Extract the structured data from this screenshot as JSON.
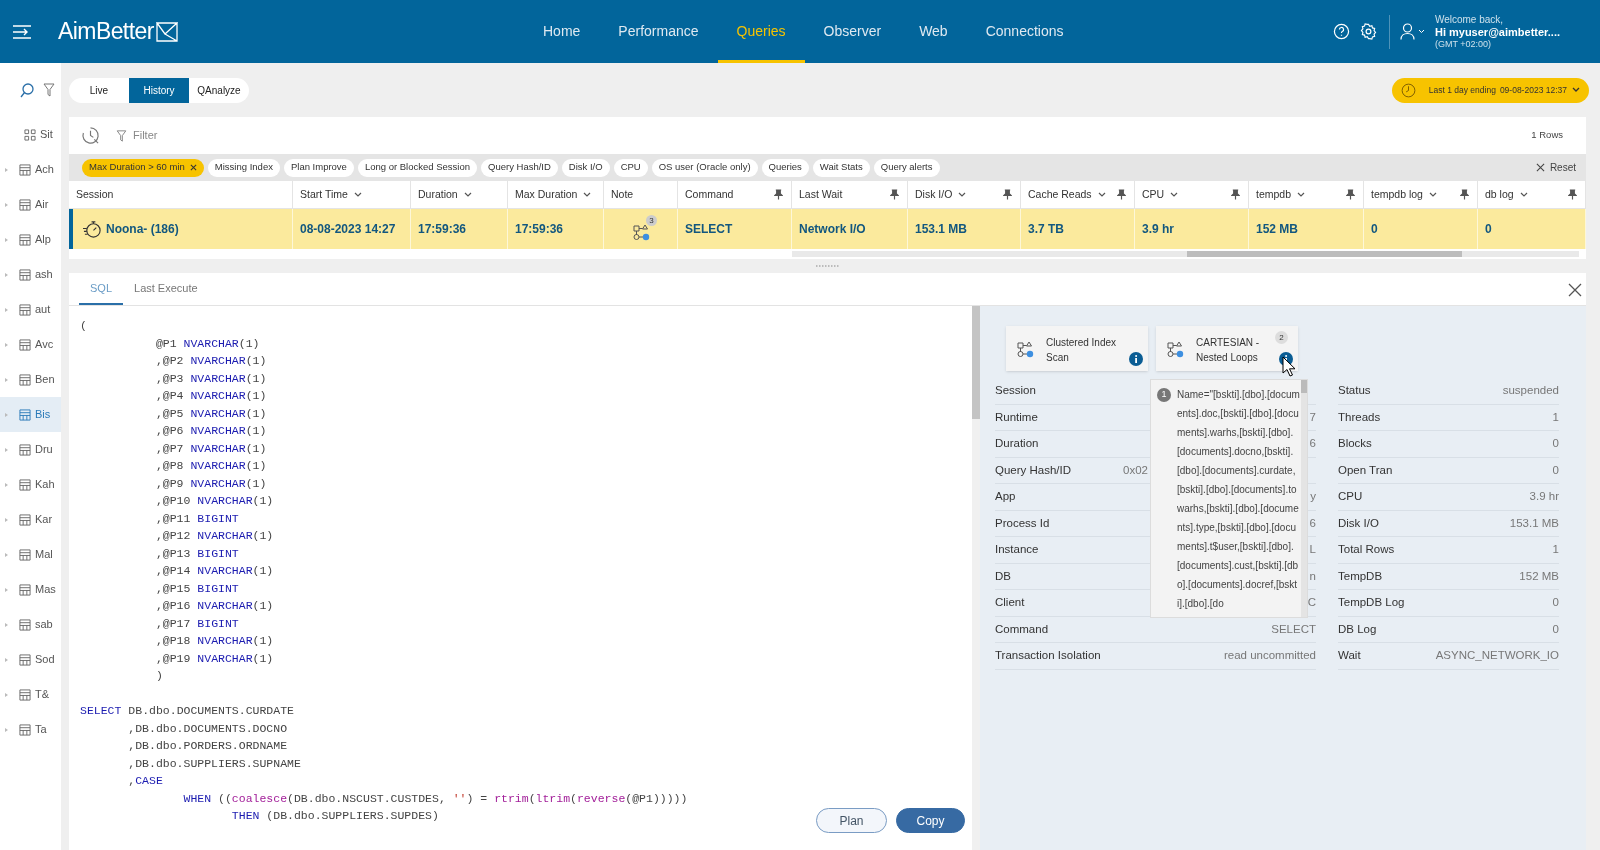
{
  "header": {
    "logo": "AimBetter",
    "nav": [
      {
        "label": "Home",
        "selected": false
      },
      {
        "label": "Performance",
        "selected": false
      },
      {
        "label": "Queries",
        "selected": true
      },
      {
        "label": "Observer",
        "selected": false
      },
      {
        "label": "Web",
        "selected": false
      },
      {
        "label": "Connections",
        "selected": false
      }
    ],
    "welcome": "Welcome back,",
    "user": "Hi myuser@aimbetter....",
    "timezone": "(GMT +02:00)"
  },
  "sidebar": {
    "items": [
      {
        "label": "Sit",
        "kind": "grid",
        "selected": false
      },
      {
        "label": "Ach",
        "kind": "table",
        "selected": false
      },
      {
        "label": "Air",
        "kind": "table",
        "selected": false
      },
      {
        "label": "Alp",
        "kind": "table",
        "selected": false
      },
      {
        "label": "ash",
        "kind": "table",
        "selected": false
      },
      {
        "label": "aut",
        "kind": "table",
        "selected": false
      },
      {
        "label": "Avc",
        "kind": "table",
        "selected": false
      },
      {
        "label": "Ben",
        "kind": "table",
        "selected": false
      },
      {
        "label": "Bis",
        "kind": "table",
        "selected": true
      },
      {
        "label": "Dru",
        "kind": "table",
        "selected": false
      },
      {
        "label": "Kah",
        "kind": "table",
        "selected": false
      },
      {
        "label": "Kar",
        "kind": "table",
        "selected": false
      },
      {
        "label": "Mal",
        "kind": "table",
        "selected": false
      },
      {
        "label": "Mas",
        "kind": "table",
        "selected": false
      },
      {
        "label": "sab",
        "kind": "table",
        "selected": false
      },
      {
        "label": "Sod",
        "kind": "table",
        "selected": false
      },
      {
        "label": "T&",
        "kind": "table",
        "selected": false
      },
      {
        "label": "Ta",
        "kind": "table",
        "selected": false
      }
    ]
  },
  "mode_tabs": [
    {
      "label": "Live",
      "selected": false
    },
    {
      "label": "History",
      "selected": true
    },
    {
      "label": "QAnalyze",
      "selected": false
    }
  ],
  "time_range": {
    "label": "Last 1 day ending",
    "value": "09-08-2023 12:37"
  },
  "filter_bar": {
    "filter_label": "Filter",
    "row_count": "1 Rows",
    "reset": "Reset",
    "chips": [
      {
        "label": "Max Duration > 60 min",
        "selected": true
      },
      {
        "label": "Missing Index",
        "selected": false
      },
      {
        "label": "Plan Improve",
        "selected": false
      },
      {
        "label": "Long or Blocked Session",
        "selected": false
      },
      {
        "label": "Query Hash/ID",
        "selected": false
      },
      {
        "label": "Disk I/O",
        "selected": false
      },
      {
        "label": "CPU",
        "selected": false
      },
      {
        "label": "OS user (Oracle only)",
        "selected": false
      },
      {
        "label": "Queries",
        "selected": false
      },
      {
        "label": "Wait Stats",
        "selected": false
      },
      {
        "label": "Query alerts",
        "selected": false
      }
    ]
  },
  "table": {
    "columns": [
      {
        "label": "Session",
        "sortable": false,
        "pin": false
      },
      {
        "label": "Start Time",
        "sortable": true,
        "pin": false
      },
      {
        "label": "Duration",
        "sortable": true,
        "pin": false
      },
      {
        "label": "Max Duration",
        "sortable": true,
        "pin": false
      },
      {
        "label": "Note",
        "sortable": false,
        "pin": false
      },
      {
        "label": "Command",
        "sortable": false,
        "pin": true
      },
      {
        "label": "Last Wait",
        "sortable": false,
        "pin": true
      },
      {
        "label": "Disk I/O",
        "sortable": true,
        "pin": true
      },
      {
        "label": "Cache Reads",
        "sortable": true,
        "pin": true
      },
      {
        "label": "CPU",
        "sortable": true,
        "pin": true
      },
      {
        "label": "tempdb",
        "sortable": true,
        "pin": true
      },
      {
        "label": "tempdb log",
        "sortable": true,
        "pin": true
      },
      {
        "label": "db log",
        "sortable": true,
        "pin": true
      }
    ],
    "rows": [
      {
        "selected": true,
        "cells": [
          {
            "kind": "session",
            "text": "Noona- (186)"
          },
          {
            "kind": "text",
            "text": "08-08-2023 14:27"
          },
          {
            "kind": "text",
            "text": "17:59:36"
          },
          {
            "kind": "text",
            "text": "17:59:36"
          },
          {
            "kind": "plan",
            "count": "3"
          },
          {
            "kind": "text",
            "text": "SELECT"
          },
          {
            "kind": "text",
            "text": "Network I/O"
          },
          {
            "kind": "text",
            "text": "153.1 MB"
          },
          {
            "kind": "text",
            "text": "3.7 TB"
          },
          {
            "kind": "text",
            "text": "3.9 hr"
          },
          {
            "kind": "text",
            "text": "152 MB"
          },
          {
            "kind": "text",
            "text": "0"
          },
          {
            "kind": "text",
            "text": "0"
          }
        ]
      }
    ]
  },
  "detail_tabs": [
    {
      "label": "SQL",
      "selected": true
    },
    {
      "label": "Last Execute",
      "selected": false
    }
  ],
  "sql": {
    "blocks": [
      {
        "lines": [
          [
            {
              "kind": "plain",
              "text": "("
            }
          ],
          [
            {
              "kind": "plain",
              "text": "           @P1 "
            },
            {
              "kind": "keyword",
              "text": "NVARCHAR"
            },
            {
              "kind": "plain",
              "text": "(1)"
            }
          ],
          [
            {
              "kind": "plain",
              "text": "           ,@P2 "
            },
            {
              "kind": "keyword",
              "text": "NVARCHAR"
            },
            {
              "kind": "plain",
              "text": "(1)"
            }
          ],
          [
            {
              "kind": "plain",
              "text": "           ,@P3 "
            },
            {
              "kind": "keyword",
              "text": "NVARCHAR"
            },
            {
              "kind": "plain",
              "text": "(1)"
            }
          ],
          [
            {
              "kind": "plain",
              "text": "           ,@P4 "
            },
            {
              "kind": "keyword",
              "text": "NVARCHAR"
            },
            {
              "kind": "plain",
              "text": "(1)"
            }
          ],
          [
            {
              "kind": "plain",
              "text": "           ,@P5 "
            },
            {
              "kind": "keyword",
              "text": "NVARCHAR"
            },
            {
              "kind": "plain",
              "text": "(1)"
            }
          ],
          [
            {
              "kind": "plain",
              "text": "           ,@P6 "
            },
            {
              "kind": "keyword",
              "text": "NVARCHAR"
            },
            {
              "kind": "plain",
              "text": "(1)"
            }
          ],
          [
            {
              "kind": "plain",
              "text": "           ,@P7 "
            },
            {
              "kind": "keyword",
              "text": "NVARCHAR"
            },
            {
              "kind": "plain",
              "text": "(1)"
            }
          ],
          [
            {
              "kind": "plain",
              "text": "           ,@P8 "
            },
            {
              "kind": "keyword",
              "text": "NVARCHAR"
            },
            {
              "kind": "plain",
              "text": "(1)"
            }
          ],
          [
            {
              "kind": "plain",
              "text": "           ,@P9 "
            },
            {
              "kind": "keyword",
              "text": "NVARCHAR"
            },
            {
              "kind": "plain",
              "text": "(1)"
            }
          ],
          [
            {
              "kind": "plain",
              "text": "           ,@P10 "
            },
            {
              "kind": "keyword",
              "text": "NVARCHAR"
            },
            {
              "kind": "plain",
              "text": "(1)"
            }
          ],
          [
            {
              "kind": "plain",
              "text": "           ,@P11 "
            },
            {
              "kind": "keyword",
              "text": "BIGINT"
            }
          ],
          [
            {
              "kind": "plain",
              "text": "           ,@P12 "
            },
            {
              "kind": "keyword",
              "text": "NVARCHAR"
            },
            {
              "kind": "plain",
              "text": "(1)"
            }
          ],
          [
            {
              "kind": "plain",
              "text": "           ,@P13 "
            },
            {
              "kind": "keyword",
              "text": "BIGINT"
            }
          ],
          [
            {
              "kind": "plain",
              "text": "           ,@P14 "
            },
            {
              "kind": "keyword",
              "text": "NVARCHAR"
            },
            {
              "kind": "plain",
              "text": "(1)"
            }
          ],
          [
            {
              "kind": "plain",
              "text": "           ,@P15 "
            },
            {
              "kind": "keyword",
              "text": "BIGINT"
            }
          ],
          [
            {
              "kind": "plain",
              "text": "           ,@P16 "
            },
            {
              "kind": "keyword",
              "text": "NVARCHAR"
            },
            {
              "kind": "plain",
              "text": "(1)"
            }
          ],
          [
            {
              "kind": "plain",
              "text": "           ,@P17 "
            },
            {
              "kind": "keyword",
              "text": "BIGINT"
            }
          ],
          [
            {
              "kind": "plain",
              "text": "           ,@P18 "
            },
            {
              "kind": "keyword",
              "text": "NVARCHAR"
            },
            {
              "kind": "plain",
              "text": "(1)"
            }
          ],
          [
            {
              "kind": "plain",
              "text": "           ,@P19 "
            },
            {
              "kind": "keyword",
              "text": "NVARCHAR"
            },
            {
              "kind": "plain",
              "text": "(1)"
            }
          ],
          [
            {
              "kind": "plain",
              "text": "           )"
            }
          ]
        ]
      },
      {
        "lines": [
          [
            {
              "kind": "keyword",
              "text": "SELECT"
            },
            {
              "kind": "plain",
              "text": " DB.dbo.DOCUMENTS.CURDATE"
            }
          ],
          [
            {
              "kind": "plain",
              "text": "       ,DB.dbo.DOCUMENTS.DOCNO"
            }
          ],
          [
            {
              "kind": "plain",
              "text": "       ,DB.dbo.PORDERS.ORDNAME"
            }
          ],
          [
            {
              "kind": "plain",
              "text": "       ,DB.dbo.SUPPLIERS.SUPNAME"
            }
          ],
          [
            {
              "kind": "plain",
              "text": "       ,"
            },
            {
              "kind": "keyword",
              "text": "CASE"
            }
          ],
          [
            {
              "kind": "keyword",
              "text": "               WHEN"
            },
            {
              "kind": "plain",
              "text": " (("
            },
            {
              "kind": "function",
              "text": "coalesce"
            },
            {
              "kind": "plain",
              "text": "(DB.dbo.NSCUST.CUSTDES, "
            },
            {
              "kind": "string",
              "text": "''"
            },
            {
              "kind": "plain",
              "text": ") = "
            },
            {
              "kind": "function",
              "text": "rtrim"
            },
            {
              "kind": "plain",
              "text": "("
            },
            {
              "kind": "function",
              "text": "ltrim"
            },
            {
              "kind": "plain",
              "text": "("
            },
            {
              "kind": "function",
              "text": "reverse"
            },
            {
              "kind": "plain",
              "text": "(@P1)))))"
            }
          ],
          [
            {
              "kind": "keyword",
              "text": "                      THEN"
            },
            {
              "kind": "plain",
              "text": " (DB.dbo.SUPPLIERS.SUPDES)"
            }
          ]
        ]
      }
    ]
  },
  "buttons": [
    {
      "label": "Plan",
      "kind": "secondary"
    },
    {
      "label": "Copy",
      "kind": "primary"
    }
  ],
  "plan_nodes": [
    {
      "label": "Clustered Index Scan"
    },
    {
      "label": "CARTESIAN - Nested Loops",
      "count": "2"
    }
  ],
  "tooltip": {
    "number": "1",
    "text": "Name=\"[bskti].[dbo].[documents].doc,[bskti].[dbo].[documents].warhs,[bskti].[dbo].[documents].docno,[bskti].[dbo].[documents].curdate,[bskti].[dbo].[documents].towarhs,[bskti].[dbo].[documents].type,[bskti].[dbo].[documents].t$user,[bskti].[dbo].[documents].cust,[bskti].[dbo].[documents].docref,[bskti].[dbo].[do"
  },
  "details": {
    "left": [
      {
        "label": "Session"
      },
      {
        "label": "Runtime",
        "value": "7",
        "kind": "end"
      },
      {
        "label": "Duration",
        "value": "6",
        "kind": "end"
      },
      {
        "label": "Query Hash/ID",
        "value": "0x02",
        "kind": "start"
      },
      {
        "label": "App",
        "value": "y",
        "kind": "end"
      },
      {
        "label": "Process Id",
        "value": "6",
        "kind": "end"
      },
      {
        "label": "Instance",
        "value": "L",
        "kind": "end"
      },
      {
        "label": "DB",
        "value": "n",
        "kind": "end"
      },
      {
        "label": "Client",
        "value": "C",
        "kind": "end"
      },
      {
        "label": "Command",
        "value": "SELECT",
        "kind": "end"
      },
      {
        "label": "Transaction Isolation",
        "value": "read uncommitted",
        "kind": "end"
      }
    ],
    "right": [
      {
        "label": "Status",
        "value": "suspended",
        "kind": "end"
      },
      {
        "label": "Threads",
        "value": "1",
        "kind": "end"
      },
      {
        "label": "Blocks",
        "value": "0",
        "kind": "end"
      },
      {
        "label": "Open Tran",
        "value": "0",
        "kind": "end"
      },
      {
        "label": "CPU",
        "value": "3.9 hr",
        "kind": "end"
      },
      {
        "label": "Disk I/O",
        "value": "153.1 MB",
        "kind": "end"
      },
      {
        "label": "Total Rows",
        "value": "1",
        "kind": "end"
      },
      {
        "label": "TempDB",
        "value": "152 MB",
        "kind": "end"
      },
      {
        "label": "TempDB Log",
        "value": "0",
        "kind": "end"
      },
      {
        "label": "DB Log",
        "value": "0",
        "kind": "end"
      },
      {
        "label": "Wait",
        "value": "ASYNC_NETWORK_IO",
        "kind": "end"
      }
    ]
  }
}
